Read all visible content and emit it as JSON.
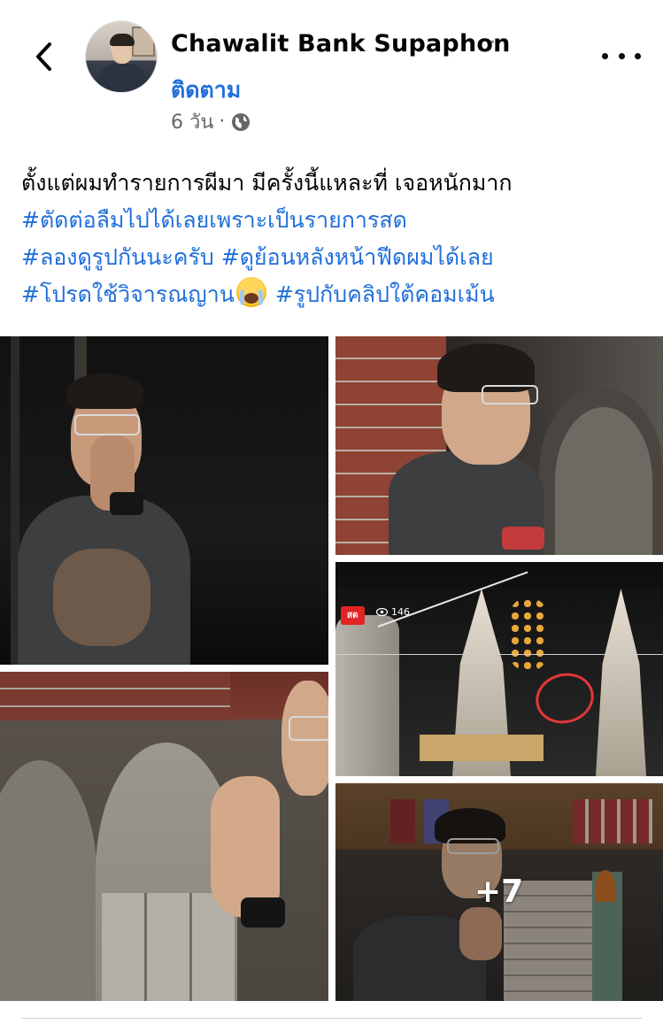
{
  "header": {
    "author_name": "Chawalit Bank Supaphon",
    "author_separator": "·",
    "follow_label": "ติดตาม",
    "timestamp": "6 วัน",
    "meta_separator": "·",
    "privacy_icon": "globe-icon",
    "back_icon": "chevron-left-icon",
    "more_icon": "more-horizontal-icon"
  },
  "post": {
    "text_line1": "ตั้งแต่ผมทำรายการผีมา มีครั้งนี้แหละที่ เจอหนักมาก",
    "hashtag1": "#ตัดต่อลืมไปได้เลยเพราะเป็นรายการสด",
    "hashtag2": "#ลองดูรูปกันนะครับ",
    "hashtag3": "#ดูย้อนหลังหน้าฟีดผมได้เลย",
    "hashtag4": "#โปรดใช้วิจารณญาน",
    "emoji": "face-screaming-in-fear",
    "hashtag5": "#รูปกับคลิปใต้คอมเม้น"
  },
  "photos": {
    "live_badge": "สด",
    "view_count": "146",
    "more_count": "+7"
  },
  "colors": {
    "link": "#216fdb",
    "text": "#050505",
    "secondary": "#65676b",
    "live": "#e02424"
  }
}
